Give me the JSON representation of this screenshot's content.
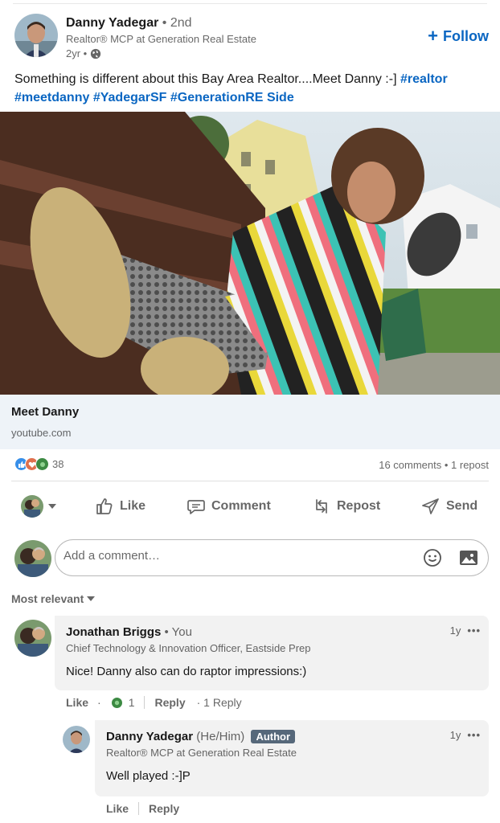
{
  "colors": {
    "link_blue": "#0a66c2",
    "muted": "#666666",
    "bubble": "#f2f2f2",
    "author_badge": "#56687a",
    "link_card": "#eef3f8"
  },
  "post": {
    "author_name": "Danny Yadegar",
    "degree": "• 2nd",
    "headline": "Realtor® MCP at Generation Real Estate",
    "time": "2yr •",
    "visibility_icon": "globe-icon",
    "follow_label": "Follow",
    "text": "Something is different about this Bay Area Realtor....Meet Danny :-] ",
    "hashtags": [
      "#realtor",
      "#meetdanny",
      "#YadegarSF",
      "#GenerationRE"
    ],
    "trailing_text": "Side",
    "link_title": "Meet Danny",
    "link_domain": "youtube.com"
  },
  "social": {
    "reaction_count": "38",
    "reaction_icons": [
      "like-icon",
      "love-icon",
      "support-icon"
    ],
    "summary": "16 comments • 1 repost"
  },
  "actions": {
    "like": "Like",
    "comment": "Comment",
    "repost": "Repost",
    "send": "Send"
  },
  "comment_input": {
    "placeholder": "Add a comment…"
  },
  "sort": {
    "label": "Most relevant"
  },
  "comments": [
    {
      "name": "Jonathan Briggs",
      "meta": "• You",
      "headline": "Chief Technology & Innovation Officer, Eastside Prep",
      "text": "Nice! Danny also can do raptor impressions:)",
      "time": "1y",
      "like_label": "Like",
      "reaction_count": "1",
      "reply_label": "Reply",
      "reply_count": "· 1 Reply"
    }
  ],
  "replies": [
    {
      "name": "Danny Yadegar",
      "pronouns": "(He/Him)",
      "badge": "Author",
      "headline": "Realtor® MCP at Generation Real Estate",
      "text": "Well played :-]P",
      "time": "1y",
      "like_label": "Like",
      "reply_label": "Reply"
    }
  ],
  "more_icon_label": "•••"
}
